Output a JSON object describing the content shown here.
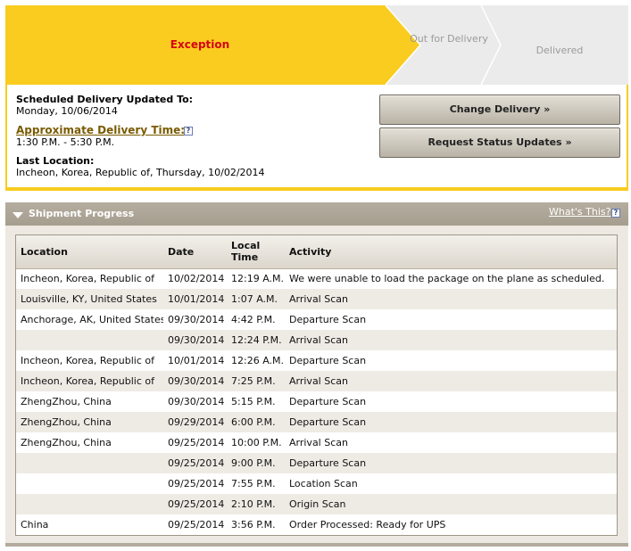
{
  "status_steps": {
    "exception": "Exception",
    "out_for_delivery": "Out for Delivery",
    "delivered": "Delivered",
    "active_color": "#f9cc1f",
    "inactive_color": "#ebebeb",
    "exception_text_color": "#d40511"
  },
  "delivery_info": {
    "scheduled_title": "Scheduled Delivery Updated To:",
    "scheduled_date": "Monday, 10/06/2014",
    "approx_time_link": "Approximate Delivery Time:",
    "approx_time_value": "1:30 P.M. - 5:30 P.M.",
    "last_location_title": "Last Location:",
    "last_location_value": "Incheon, Korea, Republic of, Thursday, 10/02/2014",
    "help_glyph": "?"
  },
  "actions": {
    "change_delivery": "Change Delivery »",
    "request_status": "Request Status Updates »"
  },
  "shipment_progress": {
    "title": "Shipment Progress",
    "whats_this": "What's This?",
    "help_glyph": "?",
    "columns": {
      "location": "Location",
      "date": "Date",
      "local_time": "Local Time",
      "activity": "Activity"
    },
    "rows": [
      {
        "location": "Incheon, Korea, Republic of",
        "date": "10/02/2014",
        "time": "12:19 A.M.",
        "activity": "We were unable to load the package on the plane as scheduled."
      },
      {
        "location": "Louisville, KY, United States",
        "date": "10/01/2014",
        "time": "1:07 A.M.",
        "activity": "Arrival Scan"
      },
      {
        "location": "Anchorage, AK, United States",
        "date": "09/30/2014",
        "time": "4:42 P.M.",
        "activity": "Departure Scan"
      },
      {
        "location": "",
        "date": "09/30/2014",
        "time": "12:24 P.M.",
        "activity": "Arrival Scan"
      },
      {
        "location": "Incheon, Korea, Republic of",
        "date": "10/01/2014",
        "time": "12:26 A.M.",
        "activity": "Departure Scan"
      },
      {
        "location": "Incheon, Korea, Republic of",
        "date": "09/30/2014",
        "time": "7:25 P.M.",
        "activity": "Arrival Scan"
      },
      {
        "location": "ZhengZhou, China",
        "date": "09/30/2014",
        "time": "5:15 P.M.",
        "activity": "Departure Scan"
      },
      {
        "location": "ZhengZhou, China",
        "date": "09/29/2014",
        "time": "6:00 P.M.",
        "activity": "Departure Scan"
      },
      {
        "location": "ZhengZhou, China",
        "date": "09/25/2014",
        "time": "10:00 P.M.",
        "activity": "Arrival Scan"
      },
      {
        "location": "",
        "date": "09/25/2014",
        "time": "9:00 P.M.",
        "activity": "Departure Scan"
      },
      {
        "location": "",
        "date": "09/25/2014",
        "time": "7:55 P.M.",
        "activity": "Location Scan"
      },
      {
        "location": "",
        "date": "09/25/2014",
        "time": "2:10 P.M.",
        "activity": "Origin Scan"
      },
      {
        "location": "China",
        "date": "09/25/2014",
        "time": "3:56 P.M.",
        "activity": "Order Processed: Ready for UPS"
      }
    ]
  }
}
